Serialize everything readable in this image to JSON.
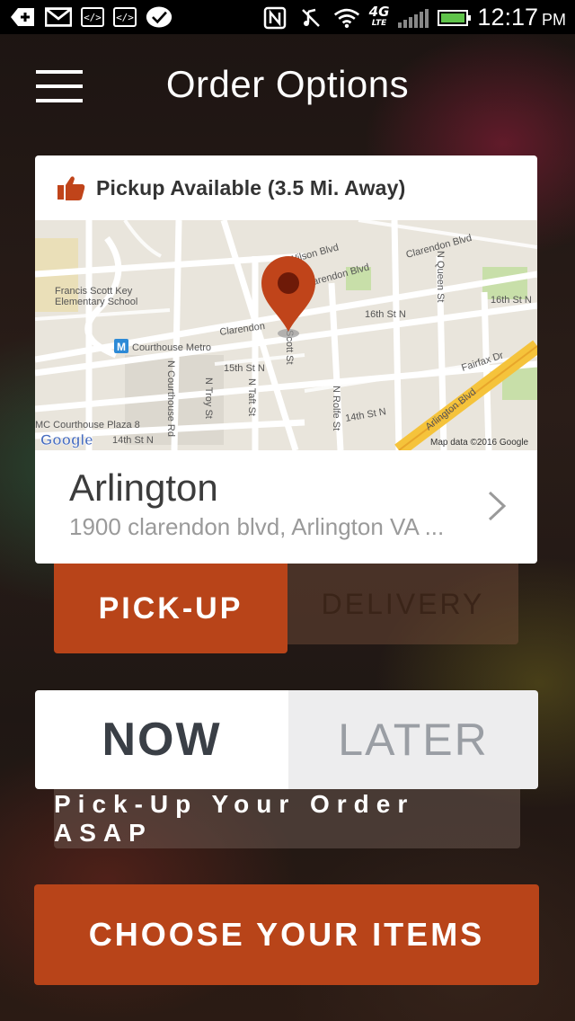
{
  "status_bar": {
    "time": "12:17",
    "ampm": "PM",
    "network": "4G",
    "network_sub": "LTE",
    "icons": [
      "add-icon",
      "gmail-icon",
      "code-icon",
      "code-icon",
      "check-bubble-icon",
      "nfc-icon",
      "mute-icon",
      "wifi-icon",
      "signal-icon",
      "battery-icon"
    ]
  },
  "header": {
    "title": "Order Options",
    "menu_icon": "hamburger-menu-icon"
  },
  "store_card": {
    "pickup_status": "Pickup Available (3.5 Mi. Away)",
    "status_icon": "thumbs-up-icon",
    "store_name": "Arlington",
    "store_address": "1900 clarendon blvd, Arlington VA ...",
    "map": {
      "labels": {
        "wilson": "Wilson Blvd",
        "clarendon_ne": "Clarendon Blvd",
        "clarendon_mid": "arendon Blvd",
        "clarendon_w": "Clarendon",
        "school1": "Francis Scott Key",
        "school2": "Elementary School",
        "metro": "Courthouse Metro",
        "n_queen": "N Queen St",
        "n_16th_right": "16th St N",
        "n_16th_mid": "16th St N",
        "n_15th": "15th St N",
        "n_14th_right": "14th St N",
        "n_14th_left": "14th St N",
        "scott": "Scott St",
        "n_courthouse": "N Courthouse Rd",
        "n_troy": "N Troy St",
        "n_taft": "N Taft St",
        "n_rolfe": "N Rolfe St",
        "fairfax": "Fairfax Dr",
        "arlington_blvd": "Arlington Blvd",
        "plaza": "MC Courthouse Plaza 8",
        "google": "Google",
        "map_data": "Map data ©2016 Google"
      },
      "colors": {
        "land": "#e9e5dc",
        "road": "#ffffff",
        "highway": "#f5c33b",
        "park": "#c8dfa9",
        "school": "#eadfb8",
        "pin": "#c0441a"
      }
    }
  },
  "order_type": {
    "pickup_label": "PICK-UP",
    "delivery_label": "DELIVERY",
    "selected": "PICK-UP"
  },
  "timing": {
    "now_label": "NOW",
    "later_label": "LATER",
    "selected": "NOW",
    "description": "Pick-Up Your Order ASAP"
  },
  "cta": {
    "label": "CHOOSE YOUR ITEMS"
  },
  "colors": {
    "accent": "#b84419",
    "card_bg": "#ffffff",
    "text_dark": "#3c3c3c",
    "text_muted": "#9a9a9a"
  }
}
